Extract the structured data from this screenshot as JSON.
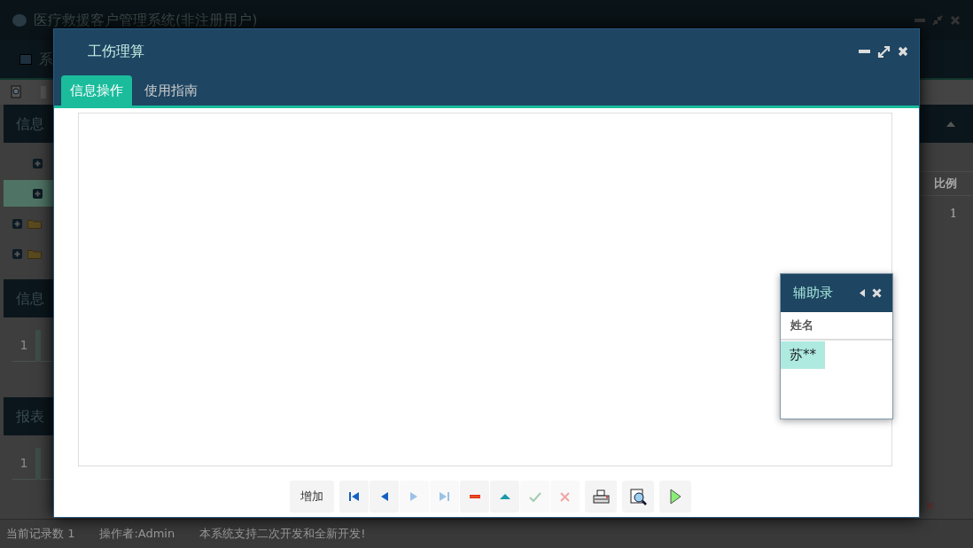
{
  "app": {
    "title": "医疗救援客户管理系统(非注册用户)",
    "menu": [
      {
        "label": "系"
      }
    ],
    "sections": [
      {
        "title": "信息"
      },
      {
        "title": "信息",
        "grid_rows": [
          {
            "number": "1"
          }
        ]
      },
      {
        "title": "报表",
        "grid_rows": [
          {
            "number": "1"
          }
        ]
      }
    ],
    "tree": [
      {
        "kind": "leaf",
        "selected": false
      },
      {
        "kind": "leaf",
        "selected": true
      },
      {
        "kind": "folder",
        "selected": false
      },
      {
        "kind": "folder",
        "selected": false
      }
    ],
    "right_table": {
      "columns": [
        "比例"
      ],
      "rows": [
        [
          "1"
        ]
      ]
    },
    "status_bar": [
      "当前记录数 1",
      "操作者:Admin",
      "本系统支持二次开发和全新开发!"
    ]
  },
  "dialog": {
    "title": "工伤理算",
    "tabs": [
      {
        "label": "信息操作",
        "selected": true
      },
      {
        "label": "使用指南",
        "selected": false
      }
    ],
    "toolbar": [
      {
        "kind": "text",
        "label": "增加"
      },
      {
        "kind": "first",
        "disabled": false
      },
      {
        "kind": "prev",
        "disabled": false
      },
      {
        "kind": "next",
        "disabled": true
      },
      {
        "kind": "last",
        "disabled": true
      },
      {
        "kind": "delete",
        "disabled": false
      },
      {
        "kind": "up",
        "disabled": false
      },
      {
        "kind": "confirm",
        "disabled": true
      },
      {
        "kind": "cancel",
        "disabled": true
      },
      {
        "kind": "print",
        "disabled": false
      },
      {
        "kind": "preview",
        "disabled": false
      },
      {
        "kind": "run",
        "disabled": false
      }
    ]
  },
  "helper": {
    "title": "辅助录",
    "columns": [
      "姓名"
    ],
    "rows": [
      {
        "name": "苏**",
        "selected": true
      }
    ]
  }
}
